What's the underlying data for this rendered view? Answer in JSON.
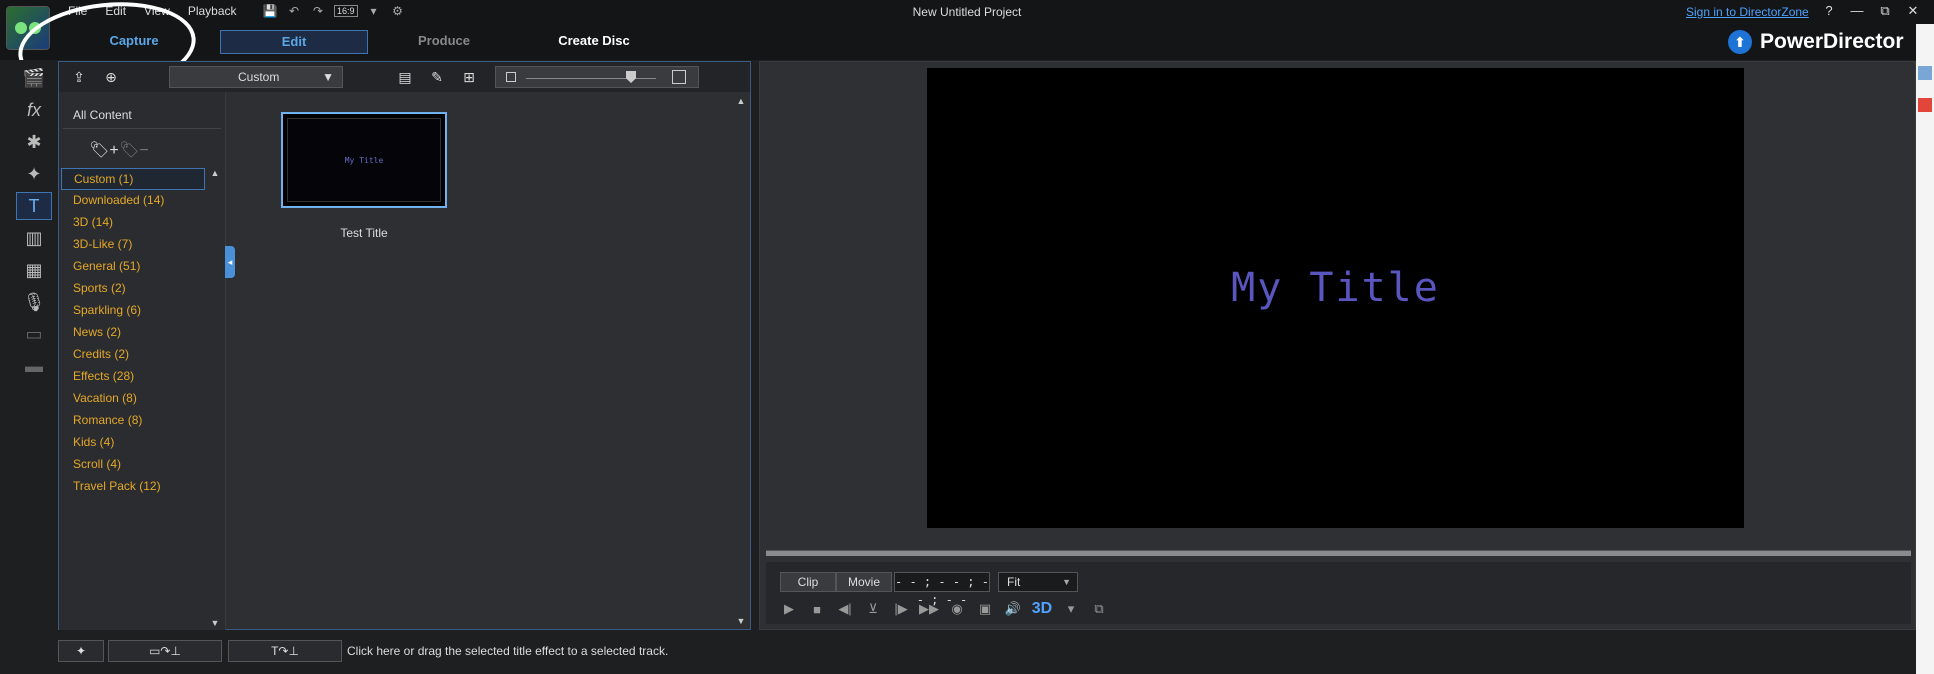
{
  "window": {
    "title": "New Untitled Project",
    "signin": "Sign in to DirectorZone",
    "help": "?",
    "minimize": "—",
    "restore": "⧉",
    "close": "✕"
  },
  "menu": {
    "file": "File",
    "edit": "Edit",
    "view": "View",
    "playback": "Playback"
  },
  "toolbar": {
    "aspect": "16:9"
  },
  "modes": {
    "capture": "Capture",
    "edit": "Edit",
    "produce": "Produce",
    "create_disc": "Create Disc"
  },
  "brand": {
    "name": "PowerDirector"
  },
  "library": {
    "filter_value": "Custom",
    "all_content": "All Content",
    "categories": [
      {
        "label": "Custom  (1)"
      },
      {
        "label": "Downloaded  (14)"
      },
      {
        "label": "3D  (14)"
      },
      {
        "label": "3D-Like  (7)"
      },
      {
        "label": "General  (51)"
      },
      {
        "label": "Sports  (2)"
      },
      {
        "label": "Sparkling  (6)"
      },
      {
        "label": "News  (2)"
      },
      {
        "label": "Credits  (2)"
      },
      {
        "label": "Effects  (28)"
      },
      {
        "label": "Vacation  (8)"
      },
      {
        "label": "Romance  (8)"
      },
      {
        "label": "Kids  (4)"
      },
      {
        "label": "Scroll  (4)"
      },
      {
        "label": "Travel Pack  (12)"
      }
    ],
    "items": [
      {
        "label": "Test Title",
        "thumb_text": "My Title"
      }
    ]
  },
  "preview": {
    "title_text": "My Title",
    "clip_tab": "Clip",
    "movie_tab": "Movie",
    "timecode": "- - ; - - ; - - ; - -",
    "fit": "Fit",
    "three_d": "3D"
  },
  "status": {
    "hint": "Click here or drag the selected title effect to a selected track."
  },
  "colors": {
    "accent": "#5aa7e8",
    "category": "#e4a826",
    "title_text": "#5a56c0"
  }
}
